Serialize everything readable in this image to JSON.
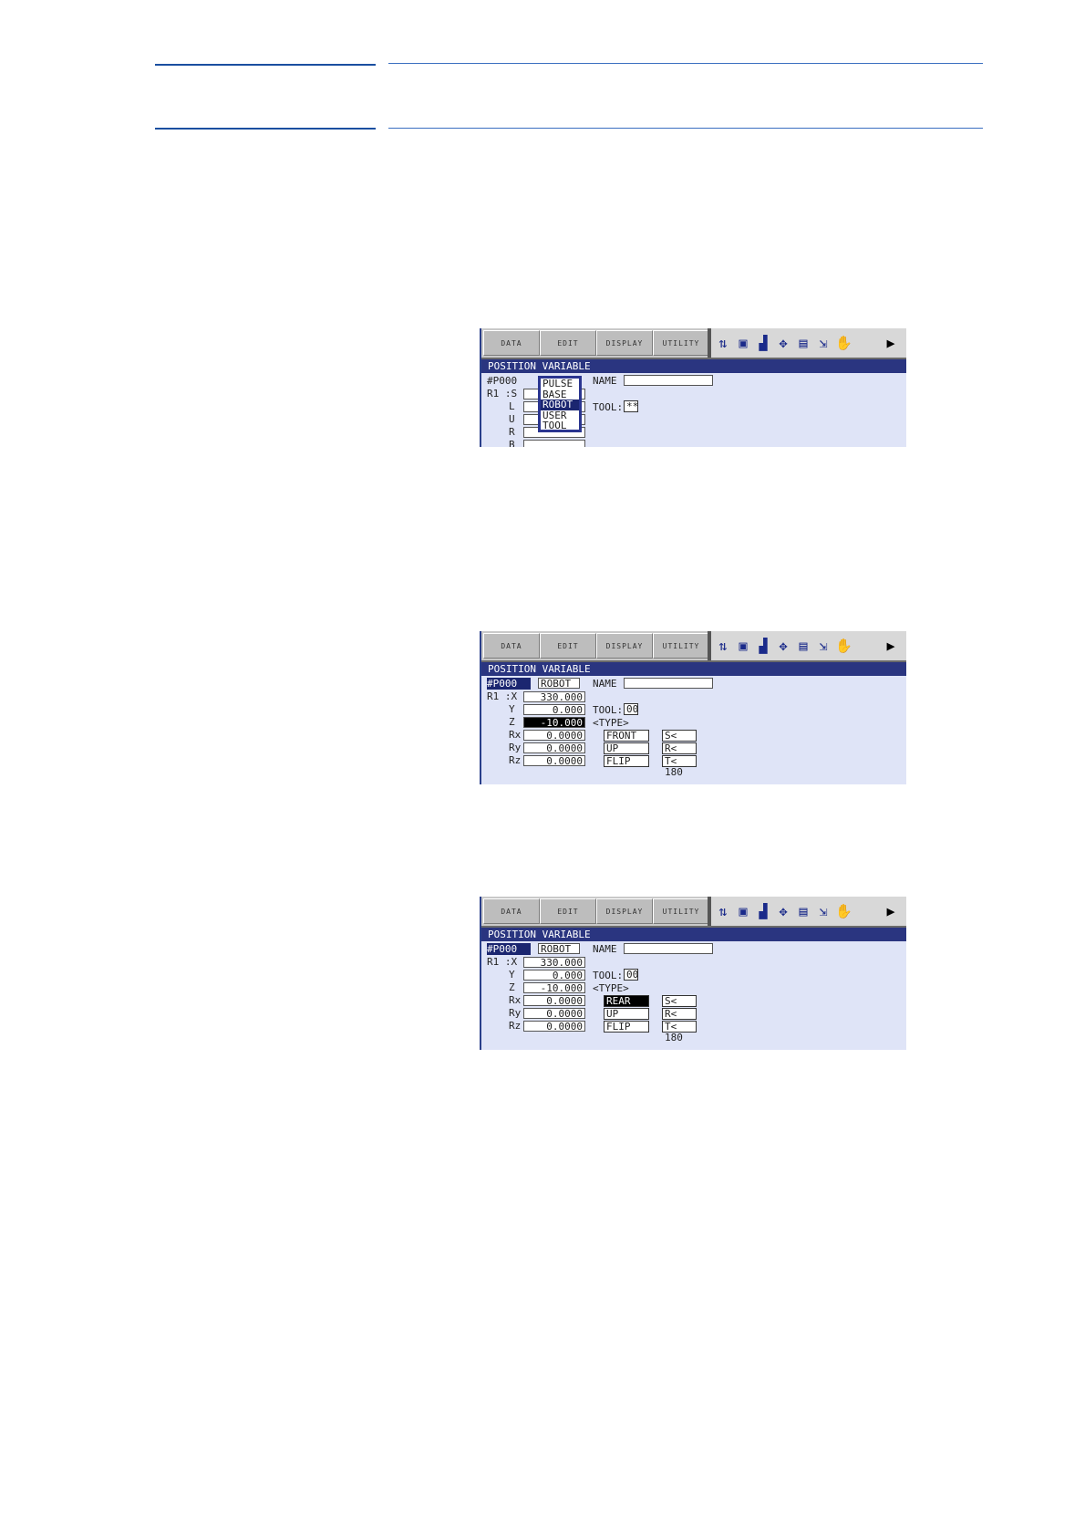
{
  "menu": {
    "tabs": [
      "DATA",
      "EDIT",
      "DISPLAY",
      "UTILITY"
    ]
  },
  "icons": [
    "robot-arm-icon",
    "edit-doc-icon",
    "signal-icon",
    "coordinate-icon",
    "monitor-icon",
    "io-icon",
    "hand-icon",
    "next-page-icon"
  ],
  "screens": [
    {
      "title": "POSITION VARIABLE",
      "var_id": "#P000",
      "name_label": "NAME",
      "name_value": "",
      "tool_label": "TOOL:",
      "tool_value": "**",
      "axis_prefix": "R1 :S",
      "axis_labels": [
        "L",
        "U",
        "R",
        "B"
      ],
      "popup_items": [
        "PULSE",
        "BASE",
        "ROBOT",
        "USER",
        "TOOL"
      ],
      "popup_selected": "ROBOT"
    },
    {
      "title": "POSITION VARIABLE",
      "var_id": "#P000",
      "frame": "ROBOT",
      "name_label": "NAME",
      "name_value": "",
      "tool_label": "TOOL:",
      "tool_value": "00",
      "type_label": "<TYPE>",
      "axis_prefix": "R1 :X",
      "rows": [
        {
          "label": "",
          "value": "330.000"
        },
        {
          "label": "Y",
          "value": "0.000"
        },
        {
          "label": "Z",
          "value": "-10.000"
        },
        {
          "label": "Rx",
          "value": "0.0000"
        },
        {
          "label": "Ry",
          "value": "0.0000"
        },
        {
          "label": "Rz",
          "value": "0.0000"
        }
      ],
      "type_values": [
        "FRONT",
        "UP",
        "FLIP"
      ],
      "angle_values": [
        "S< 180",
        "R< 180",
        "T< 180"
      ]
    },
    {
      "title": "POSITION VARIABLE",
      "var_id": "#P000",
      "frame": "ROBOT",
      "name_label": "NAME",
      "name_value": "",
      "tool_label": "TOOL:",
      "tool_value": "00",
      "type_label": "<TYPE>",
      "axis_prefix": "R1 :X",
      "rows": [
        {
          "label": "",
          "value": "330.000"
        },
        {
          "label": "Y",
          "value": "0.000"
        },
        {
          "label": "Z",
          "value": "-10.000"
        },
        {
          "label": "Rx",
          "value": "0.0000"
        },
        {
          "label": "Ry",
          "value": "0.0000"
        },
        {
          "label": "Rz",
          "value": "0.0000"
        }
      ],
      "type_values": [
        "REAR",
        "UP",
        "FLIP"
      ],
      "angle_values": [
        "S< 180",
        "R< 180",
        "T< 180"
      ]
    }
  ]
}
